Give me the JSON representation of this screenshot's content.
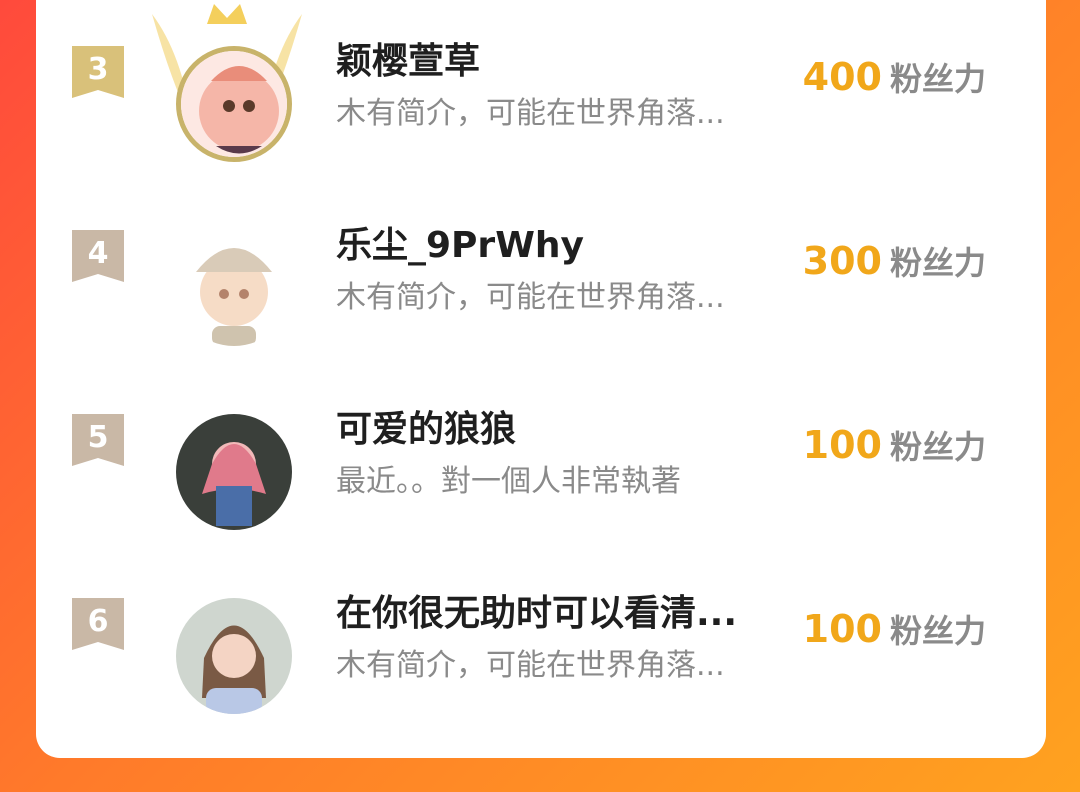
{
  "leaderboard": {
    "unit_label": "粉丝力",
    "entries": [
      {
        "rank": "3",
        "name": "颖樱萱草",
        "intro": "木有简介，可能在世界角落...",
        "score": "400"
      },
      {
        "rank": "4",
        "name": "乐尘_9PrWhy",
        "intro": "木有简介，可能在世界角落...",
        "score": "300"
      },
      {
        "rank": "5",
        "name": "可爱的狼狼",
        "intro": "最近。。對一個人非常執著",
        "score": "100"
      },
      {
        "rank": "6",
        "name": "在你很无助时可以看清...",
        "intro": "木有简介，可能在世界角落...",
        "score": "100"
      }
    ]
  },
  "colors": {
    "score": "#f1a71a",
    "rank_3_badge": "#d9c17a",
    "rank_other_badge": "#c9b8a6",
    "background_gradient": [
      "#ff4a3c",
      "#ffa21f"
    ]
  },
  "icons": [
    "rank-ribbon-icon",
    "crown-wings-icon",
    "avatar-image"
  ]
}
